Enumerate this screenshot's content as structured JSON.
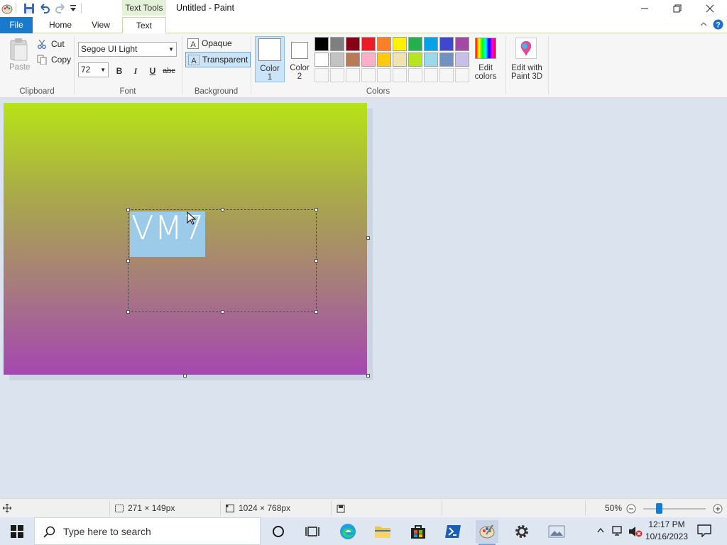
{
  "window": {
    "title": "Untitled - Paint",
    "context_tab": "Text Tools"
  },
  "tabs": {
    "file": "File",
    "home": "Home",
    "view": "View",
    "text": "Text"
  },
  "clipboard": {
    "paste": "Paste",
    "cut": "Cut",
    "copy": "Copy",
    "label": "Clipboard"
  },
  "font": {
    "family": "Segoe UI Light",
    "size": "72",
    "bold": "B",
    "italic": "I",
    "underline": "U",
    "strike": "abc",
    "label": "Font"
  },
  "background": {
    "opaque": "Opaque",
    "transparent": "Transparent",
    "label": "Background",
    "selected": "transparent"
  },
  "colors": {
    "color1_l1": "Color",
    "color1_l2": "1",
    "color2_l1": "Color",
    "color2_l2": "2",
    "edit_l1": "Edit",
    "edit_l2": "colors",
    "label": "Colors",
    "palette_row1": [
      "#000000",
      "#7f7f7f",
      "#880015",
      "#ed1c24",
      "#ff7f27",
      "#fff200",
      "#22b14c",
      "#00a2e8",
      "#3f48cc",
      "#a349a4"
    ],
    "palette_row2": [
      "#ffffff",
      "#c3c3c3",
      "#b97a57",
      "#ffaec9",
      "#ffc90e",
      "#efe4b0",
      "#b5e61d",
      "#99d9ea",
      "#7092be",
      "#c8bfe7"
    ],
    "custom_slots": 10
  },
  "paint3d": {
    "l1": "Edit with",
    "l2": "Paint 3D"
  },
  "canvas": {
    "text": "VM7",
    "gradient_top": "#b7e317",
    "gradient_bottom": "#a547b1"
  },
  "status": {
    "selection_size": "271 × 149px",
    "image_size": "1024 × 768px",
    "zoom": "50%"
  },
  "taskbar": {
    "search_placeholder": "Type here to search",
    "time": "12:17 PM",
    "date": "10/16/2023"
  }
}
